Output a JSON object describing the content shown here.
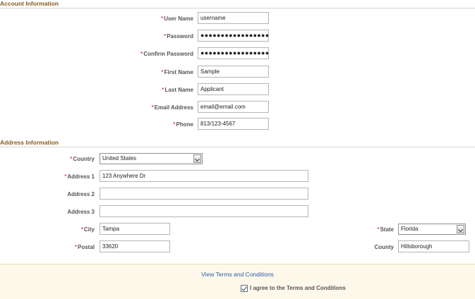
{
  "account": {
    "heading": "Account Information",
    "user_name": {
      "label": "User Name",
      "value": "username"
    },
    "password": {
      "label": "Password",
      "value": "●●●●●●●●●●●●●●●●●●●●"
    },
    "confirm_password": {
      "label": "Confirm Password",
      "value": "●●●●●●●●●●●●●●●●●●●●"
    },
    "first_name": {
      "label": "First Name",
      "value": "Sample"
    },
    "last_name": {
      "label": "Last Name",
      "value": "Applicant"
    },
    "email": {
      "label": "Email Address",
      "value": "email@email.com"
    },
    "phone": {
      "label": "Phone",
      "value": "813/123-4567"
    }
  },
  "address": {
    "heading": "Address Information",
    "country": {
      "label": "Country",
      "value": "United States"
    },
    "address1": {
      "label": "Address 1",
      "value": "123 Anywhere Dr"
    },
    "address2": {
      "label": "Address 2",
      "value": ""
    },
    "address3": {
      "label": "Address 3",
      "value": ""
    },
    "city": {
      "label": "City",
      "value": "Tampa"
    },
    "state": {
      "label": "State",
      "value": "Florida"
    },
    "postal": {
      "label": "Postal",
      "value": "33620"
    },
    "county": {
      "label": "County",
      "value": "Hillsborough"
    }
  },
  "terms": {
    "link": "View Terms and Conditions",
    "agree_label": "I agree to the Terms and Conditions",
    "agreed": true
  },
  "required_marker": "*",
  "colors": {
    "section_heading": "#8a5a1c",
    "link": "#2a5db0",
    "terms_background": "#fdf8ea",
    "required_marker": "#c00000"
  }
}
